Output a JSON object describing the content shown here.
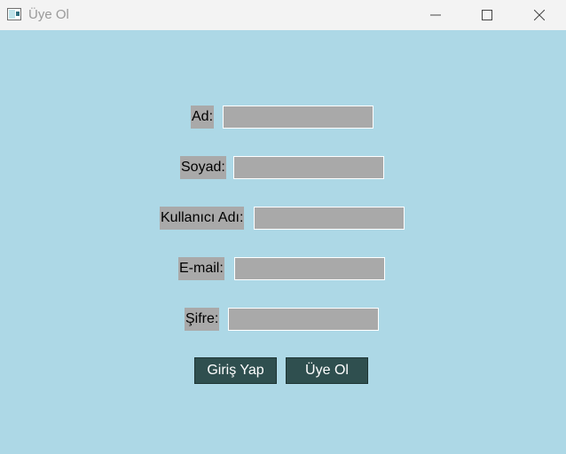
{
  "window": {
    "title": "Üye Ol"
  },
  "form": {
    "fields": [
      {
        "label": "Ad:",
        "value": ""
      },
      {
        "label": "Soyad:",
        "value": ""
      },
      {
        "label": "Kullanıcı Adı:",
        "value": ""
      },
      {
        "label": "E-mail:",
        "value": ""
      },
      {
        "label": "Şifre:",
        "value": ""
      }
    ],
    "buttons": {
      "login": "Giriş Yap",
      "register": "Üye Ol"
    }
  },
  "colors": {
    "background": "#add8e6",
    "field": "#a9a9a9",
    "button": "#2f4f4f",
    "button_text": "#ffffff",
    "titlebar": "#f3f3f3"
  }
}
